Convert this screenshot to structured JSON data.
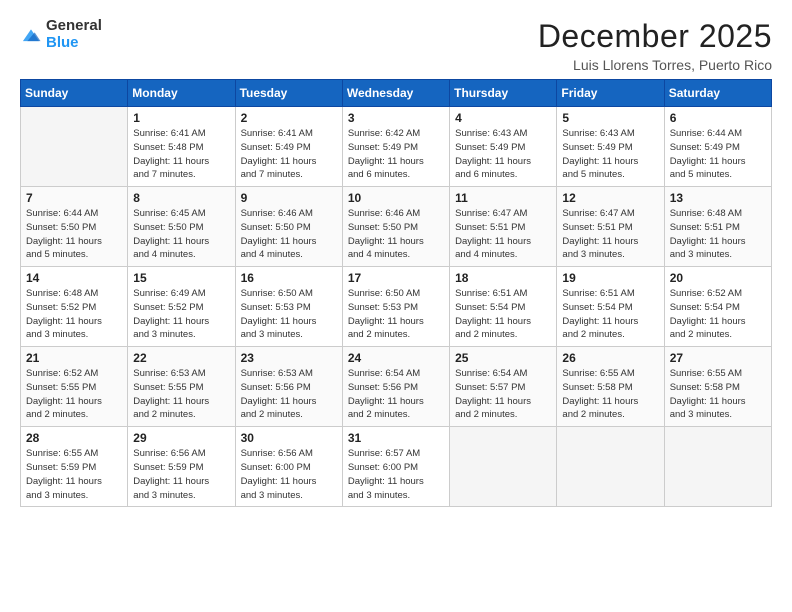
{
  "logo": {
    "general": "General",
    "blue": "Blue"
  },
  "title": "December 2025",
  "subtitle": "Luis Llorens Torres, Puerto Rico",
  "headers": [
    "Sunday",
    "Monday",
    "Tuesday",
    "Wednesday",
    "Thursday",
    "Friday",
    "Saturday"
  ],
  "weeks": [
    [
      {
        "day": "",
        "info": ""
      },
      {
        "day": "1",
        "info": "Sunrise: 6:41 AM\nSunset: 5:48 PM\nDaylight: 11 hours\nand 7 minutes."
      },
      {
        "day": "2",
        "info": "Sunrise: 6:41 AM\nSunset: 5:49 PM\nDaylight: 11 hours\nand 7 minutes."
      },
      {
        "day": "3",
        "info": "Sunrise: 6:42 AM\nSunset: 5:49 PM\nDaylight: 11 hours\nand 6 minutes."
      },
      {
        "day": "4",
        "info": "Sunrise: 6:43 AM\nSunset: 5:49 PM\nDaylight: 11 hours\nand 6 minutes."
      },
      {
        "day": "5",
        "info": "Sunrise: 6:43 AM\nSunset: 5:49 PM\nDaylight: 11 hours\nand 5 minutes."
      },
      {
        "day": "6",
        "info": "Sunrise: 6:44 AM\nSunset: 5:49 PM\nDaylight: 11 hours\nand 5 minutes."
      }
    ],
    [
      {
        "day": "7",
        "info": "Sunrise: 6:44 AM\nSunset: 5:50 PM\nDaylight: 11 hours\nand 5 minutes."
      },
      {
        "day": "8",
        "info": "Sunrise: 6:45 AM\nSunset: 5:50 PM\nDaylight: 11 hours\nand 4 minutes."
      },
      {
        "day": "9",
        "info": "Sunrise: 6:46 AM\nSunset: 5:50 PM\nDaylight: 11 hours\nand 4 minutes."
      },
      {
        "day": "10",
        "info": "Sunrise: 6:46 AM\nSunset: 5:50 PM\nDaylight: 11 hours\nand 4 minutes."
      },
      {
        "day": "11",
        "info": "Sunrise: 6:47 AM\nSunset: 5:51 PM\nDaylight: 11 hours\nand 4 minutes."
      },
      {
        "day": "12",
        "info": "Sunrise: 6:47 AM\nSunset: 5:51 PM\nDaylight: 11 hours\nand 3 minutes."
      },
      {
        "day": "13",
        "info": "Sunrise: 6:48 AM\nSunset: 5:51 PM\nDaylight: 11 hours\nand 3 minutes."
      }
    ],
    [
      {
        "day": "14",
        "info": "Sunrise: 6:48 AM\nSunset: 5:52 PM\nDaylight: 11 hours\nand 3 minutes."
      },
      {
        "day": "15",
        "info": "Sunrise: 6:49 AM\nSunset: 5:52 PM\nDaylight: 11 hours\nand 3 minutes."
      },
      {
        "day": "16",
        "info": "Sunrise: 6:50 AM\nSunset: 5:53 PM\nDaylight: 11 hours\nand 3 minutes."
      },
      {
        "day": "17",
        "info": "Sunrise: 6:50 AM\nSunset: 5:53 PM\nDaylight: 11 hours\nand 2 minutes."
      },
      {
        "day": "18",
        "info": "Sunrise: 6:51 AM\nSunset: 5:54 PM\nDaylight: 11 hours\nand 2 minutes."
      },
      {
        "day": "19",
        "info": "Sunrise: 6:51 AM\nSunset: 5:54 PM\nDaylight: 11 hours\nand 2 minutes."
      },
      {
        "day": "20",
        "info": "Sunrise: 6:52 AM\nSunset: 5:54 PM\nDaylight: 11 hours\nand 2 minutes."
      }
    ],
    [
      {
        "day": "21",
        "info": "Sunrise: 6:52 AM\nSunset: 5:55 PM\nDaylight: 11 hours\nand 2 minutes."
      },
      {
        "day": "22",
        "info": "Sunrise: 6:53 AM\nSunset: 5:55 PM\nDaylight: 11 hours\nand 2 minutes."
      },
      {
        "day": "23",
        "info": "Sunrise: 6:53 AM\nSunset: 5:56 PM\nDaylight: 11 hours\nand 2 minutes."
      },
      {
        "day": "24",
        "info": "Sunrise: 6:54 AM\nSunset: 5:56 PM\nDaylight: 11 hours\nand 2 minutes."
      },
      {
        "day": "25",
        "info": "Sunrise: 6:54 AM\nSunset: 5:57 PM\nDaylight: 11 hours\nand 2 minutes."
      },
      {
        "day": "26",
        "info": "Sunrise: 6:55 AM\nSunset: 5:58 PM\nDaylight: 11 hours\nand 2 minutes."
      },
      {
        "day": "27",
        "info": "Sunrise: 6:55 AM\nSunset: 5:58 PM\nDaylight: 11 hours\nand 3 minutes."
      }
    ],
    [
      {
        "day": "28",
        "info": "Sunrise: 6:55 AM\nSunset: 5:59 PM\nDaylight: 11 hours\nand 3 minutes."
      },
      {
        "day": "29",
        "info": "Sunrise: 6:56 AM\nSunset: 5:59 PM\nDaylight: 11 hours\nand 3 minutes."
      },
      {
        "day": "30",
        "info": "Sunrise: 6:56 AM\nSunset: 6:00 PM\nDaylight: 11 hours\nand 3 minutes."
      },
      {
        "day": "31",
        "info": "Sunrise: 6:57 AM\nSunset: 6:00 PM\nDaylight: 11 hours\nand 3 minutes."
      },
      {
        "day": "",
        "info": ""
      },
      {
        "day": "",
        "info": ""
      },
      {
        "day": "",
        "info": ""
      }
    ]
  ]
}
